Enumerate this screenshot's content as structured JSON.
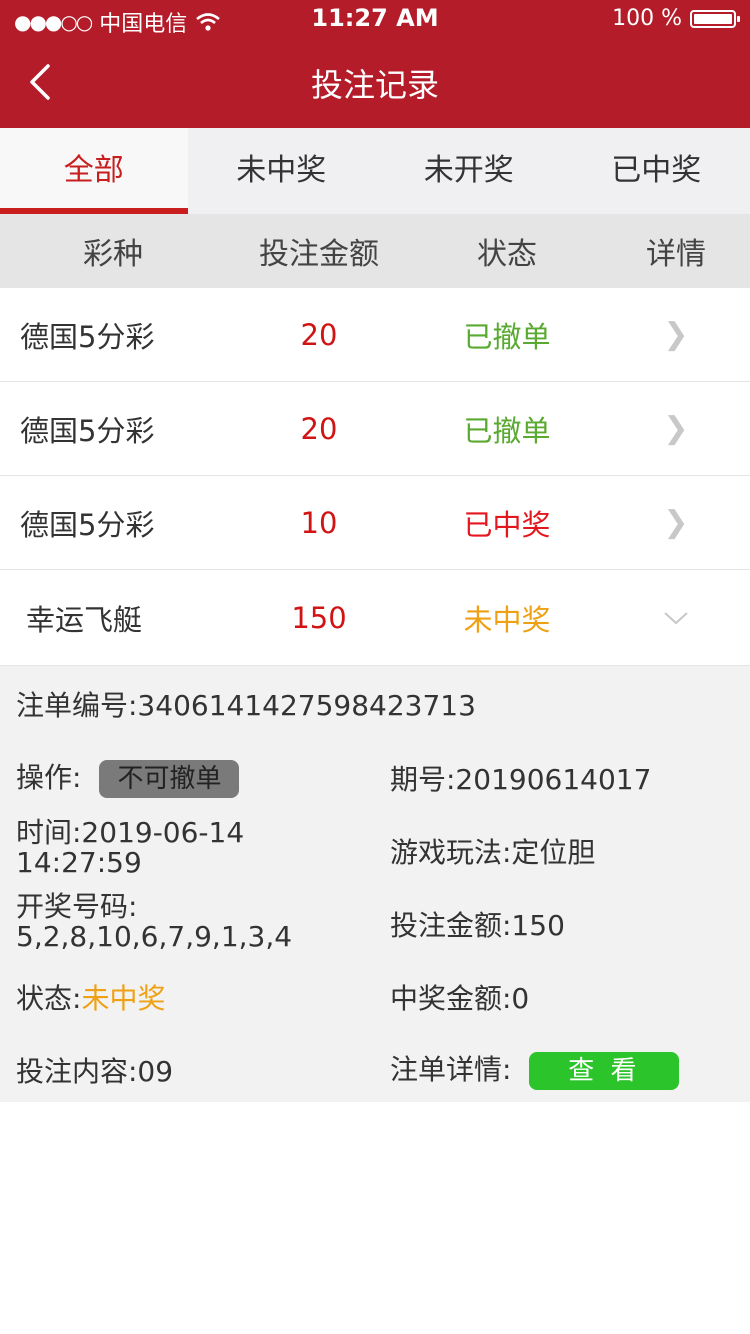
{
  "status_bar": {
    "carrier": "中国电信",
    "time": "11:27 AM",
    "battery": "100 %"
  },
  "nav": {
    "title": "投注记录"
  },
  "tabs": [
    {
      "label": "全部",
      "active": true
    },
    {
      "label": "未中奖",
      "active": false
    },
    {
      "label": "未开奖",
      "active": false
    },
    {
      "label": "已中奖",
      "active": false
    }
  ],
  "columns": [
    "彩种",
    "投注金额",
    "状态",
    "详情"
  ],
  "rows": [
    {
      "game": "德国5分彩",
      "amount": "20",
      "status": "已撤单"
    },
    {
      "game": "德国5分彩",
      "amount": "20",
      "status": "已撤单"
    },
    {
      "game": "德国5分彩",
      "amount": "10",
      "status": "已中奖"
    },
    {
      "game": "幸运飞艇",
      "amount": "150",
      "status": "未中奖"
    }
  ],
  "detail": {
    "order_no": "注单编号:340614142759842​3713",
    "operation_label": "操作:",
    "operation_button": "不可撤单",
    "period": "期号:20190614017",
    "time_label": "时间:2019-06-14",
    "time_value": "14:27:59",
    "play": "游戏玩法:定位胆",
    "draw_label": "开奖号码:",
    "draw_numbers": "5,2,8,10,6,7,9,1,3,4",
    "bet_amount": "投注金额:150",
    "status_label": "状态:",
    "status_value": "未中奖",
    "win_amount": "中奖金额:0",
    "content": "投注内容:09",
    "detail_label": "注单详情:",
    "view_button": "查 看"
  },
  "colors": {
    "brand_red": "#b41c2a",
    "tab_active": "#c81e1e",
    "cancelled_green": "#5aaa32",
    "won_red": "#e4161e",
    "lost_orange": "#eea114",
    "view_green": "#2bc42b"
  }
}
